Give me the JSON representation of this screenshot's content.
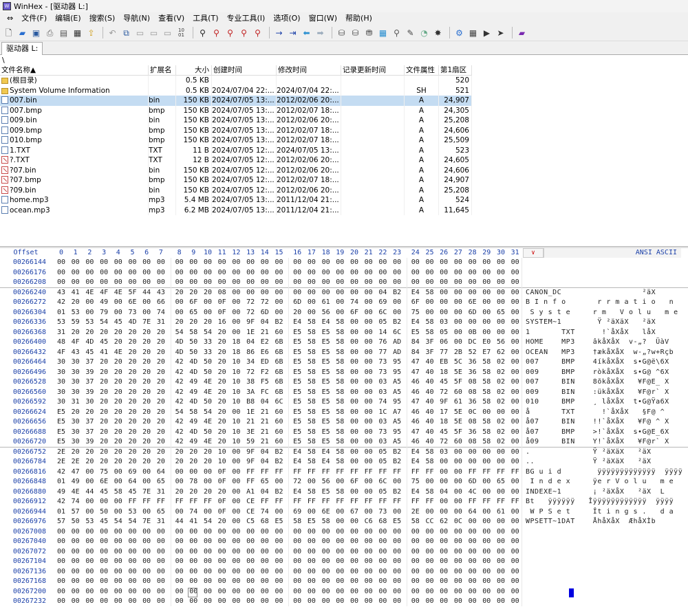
{
  "window": {
    "title": "WinHex - [驱动器 L:]"
  },
  "menu": [
    "文件(F)",
    "编辑(E)",
    "搜索(S)",
    "导航(N)",
    "查看(V)",
    "工具(T)",
    "专业工具(I)",
    "选项(O)",
    "窗口(W)",
    "帮助(H)"
  ],
  "tab": {
    "label": "驱动器 L:"
  },
  "path": "\\",
  "dir_columns": [
    "文件名称▲",
    "扩展名",
    "大小",
    "创建时间",
    "修改时间",
    "记录更新时间",
    "文件属性",
    "第1扇区"
  ],
  "dir_rows": [
    {
      "icon": "folder",
      "name": "(根目录)",
      "ext": "",
      "size": "0.5 KB",
      "created": "",
      "modified": "",
      "record": "",
      "attr": "",
      "sector": "520",
      "sel": false
    },
    {
      "icon": "folder",
      "name": "System Volume Information",
      "ext": "",
      "size": "0.5 KB",
      "created": "2024/07/04  22:...",
      "modified": "2024/07/04  22:...",
      "record": "",
      "attr": "SH",
      "sector": "521",
      "sel": false
    },
    {
      "icon": "file",
      "name": "007.bin",
      "ext": "bin",
      "size": "150 KB",
      "created": "2024/07/05  13:...",
      "modified": "2012/02/06  20:...",
      "record": "",
      "attr": "A",
      "sector": "24,907",
      "sel": true
    },
    {
      "icon": "file",
      "name": "007.bmp",
      "ext": "bmp",
      "size": "150 KB",
      "created": "2024/07/05  13:...",
      "modified": "2012/02/07  18:...",
      "record": "",
      "attr": "A",
      "sector": "24,305",
      "sel": false
    },
    {
      "icon": "file",
      "name": "009.bin",
      "ext": "bin",
      "size": "150 KB",
      "created": "2024/07/05  13:...",
      "modified": "2012/02/06  20:...",
      "record": "",
      "attr": "A",
      "sector": "25,208",
      "sel": false
    },
    {
      "icon": "file",
      "name": "009.bmp",
      "ext": "bmp",
      "size": "150 KB",
      "created": "2024/07/05  13:...",
      "modified": "2012/02/07  18:...",
      "record": "",
      "attr": "A",
      "sector": "24,606",
      "sel": false
    },
    {
      "icon": "file",
      "name": "010.bmp",
      "ext": "bmp",
      "size": "150 KB",
      "created": "2024/07/05  13:...",
      "modified": "2012/02/07  18:...",
      "record": "",
      "attr": "A",
      "sector": "25,509",
      "sel": false
    },
    {
      "icon": "file",
      "name": "1.TXT",
      "ext": "TXT",
      "size": "11 B",
      "created": "2024/07/05  12:...",
      "modified": "2024/07/05  13:...",
      "record": "",
      "attr": "A",
      "sector": "523",
      "sel": false
    },
    {
      "icon": "deleted",
      "name": "?.TXT",
      "ext": "TXT",
      "size": "12 B",
      "created": "2024/07/05  12:...",
      "modified": "2012/02/06  20:...",
      "record": "",
      "attr": "A",
      "sector": "24,605",
      "sel": false
    },
    {
      "icon": "deleted",
      "name": "?07.bin",
      "ext": "bin",
      "size": "150 KB",
      "created": "2024/07/05  12:...",
      "modified": "2012/02/06  20:...",
      "record": "",
      "attr": "A",
      "sector": "24,606",
      "sel": false
    },
    {
      "icon": "deleted",
      "name": "?07.bmp",
      "ext": "bmp",
      "size": "150 KB",
      "created": "2024/07/05  12:...",
      "modified": "2012/02/07  18:...",
      "record": "",
      "attr": "A",
      "sector": "24,907",
      "sel": false
    },
    {
      "icon": "deleted",
      "name": "?09.bin",
      "ext": "bin",
      "size": "150 KB",
      "created": "2024/07/05  12:...",
      "modified": "2012/02/06  20:...",
      "record": "",
      "attr": "A",
      "sector": "25,208",
      "sel": false
    },
    {
      "icon": "file",
      "name": "home.mp3",
      "ext": "mp3",
      "size": "5.4 MB",
      "created": "2024/07/05  13:...",
      "modified": "2011/12/04  21:...",
      "record": "",
      "attr": "A",
      "sector": "524",
      "sel": false
    },
    {
      "icon": "file",
      "name": "ocean.mp3",
      "ext": "mp3",
      "size": "6.2 MB",
      "created": "2024/07/05  13:...",
      "modified": "2011/12/04  21:...",
      "record": "",
      "attr": "A",
      "sector": "11,645",
      "sel": false
    }
  ],
  "hex_header": {
    "offset_label": "Offset",
    "columns": [
      "0",
      "1",
      "2",
      "3",
      "4",
      "5",
      "6",
      "7",
      "8",
      "9",
      "10",
      "11",
      "12",
      "13",
      "14",
      "15",
      "16",
      "17",
      "18",
      "19",
      "20",
      "21",
      "22",
      "23",
      "24",
      "25",
      "26",
      "27",
      "28",
      "29",
      "30",
      "31"
    ],
    "charset_dropdown": "∨",
    "charset_label": "ANSI ASCII"
  },
  "hex_rows": [
    {
      "off": "00266144",
      "hex": "00 00 00 00 00 00 00 00 00 00 00 00 00 00 00 00 00 00 00 00 00 00 00 00 00 00 00 00 00 00 00 00",
      "ascii": ""
    },
    {
      "off": "00266176",
      "hex": "00 00 00 00 00 00 00 00 00 00 00 00 00 00 00 00 00 00 00 00 00 00 00 00 00 00 00 00 00 00 00 00",
      "ascii": ""
    },
    {
      "off": "00266208",
      "hex": "00 00 00 00 00 00 00 00 00 00 00 00 00 00 00 00 00 00 00 00 00 00 00 00 00 00 00 00 00 00 00 00",
      "ascii": ""
    },
    {
      "off": "00266240",
      "hex": "43 41 4E 4F 4E 5F 44 43 20 20 20 08 00 00 00 00 00 00 00 00 00 00 04 B2 E4 58 00 00 00 00 00 00",
      "ascii": "CANON_DC                  ²äX"
    },
    {
      "off": "00266272",
      "hex": "42 20 00 49 00 6E 00 66 00 6F 00 0F 00 72 72 00 6D 00 61 00 74 00 69 00 6F 00 00 00 6E 00 00 00",
      "ascii": "B I n f o       r r m a t i o   n"
    },
    {
      "off": "00266304",
      "hex": "01 53 00 79 00 73 00 74 00 65 00 0F 00 72 6D 00 20 00 56 00 6F 00 6C 00 75 00 00 00 6D 00 65 00",
      "ascii": " S y s t e     r m   V o l u   m e"
    },
    {
      "off": "00266336",
      "hex": "53 59 53 54 45 4D 7E 31 20 20 20 16 00 9F 04 B2 E4 58 E4 58 00 00 05 B2 E4 58 03 00 00 00 00 00",
      "ascii": "SYSTEM~1        Ÿ ²äXäX   ²äX"
    },
    {
      "off": "00266368",
      "hex": "31 20 20 20 20 20 20 20 54 58 54 20 00 1E 21 60 E5 58 E5 58 00 00 14 6C E5 58 05 00 0B 00 00 00",
      "ascii": "1       TXT      !`åXåX   låX"
    },
    {
      "off": "00266400",
      "hex": "48 4F 4D 45 20 20 20 20 4D 50 33 20 18 04 E2 6B E5 58 E5 58 00 00 76 AD 84 3F 06 00 DC E0 56 00",
      "ascii": "HOME    MP3    âkåXåX  v-„?  ÜàV"
    },
    {
      "off": "00266432",
      "hex": "4F 43 45 41 4E 20 20 20 4D 50 33 20 18 86 E6 6B E5 58 E5 58 00 00 77 AD 84 3F 77 2B 52 E7 62 00",
      "ascii": "OCEAN   MP3    †ækåXåX  w-„?w+Rçb"
    },
    {
      "off": "00266464",
      "hex": "30 30 37 20 20 20 20 20 42 4D 50 20 10 34 ED 6B E5 58 E5 58 00 00 73 95 47 40 EB 5C 36 58 02 00",
      "ascii": "007     BMP    4íkåXåX  s•G@ë\\6X"
    },
    {
      "off": "00266496",
      "hex": "30 30 39 20 20 20 20 20 42 4D 50 20 10 72 F2 6B E5 58 E5 58 00 00 73 95 47 40 18 5E 36 58 02 00",
      "ascii": "009     BMP    ròkåXåX  s•G@ ^6X"
    },
    {
      "off": "00266528",
      "hex": "30 30 37 20 20 20 20 20 42 49 4E 20 10 38 F5 6B E5 58 E5 58 00 00 03 A5 46 40 45 5F 08 58 02 00",
      "ascii": "007     BIN    8õkåXåX   ¥F@E_ X"
    },
    {
      "off": "00266560",
      "hex": "30 30 39 20 20 20 20 20 42 49 4E 20 10 3A FC 6B E5 58 E5 58 00 00 03 A5 46 40 72 60 08 58 02 00",
      "ascii": "009     BIN    :ükåXåX   ¥F@r` X"
    },
    {
      "off": "00266592",
      "hex": "30 31 30 20 20 20 20 20 42 4D 50 20 10 B8 04 6C E5 58 E5 58 00 00 74 95 47 40 9F 61 36 58 02 00",
      "ascii": "010     BMP    ¸ låXåX  t•G@Ÿa6X"
    },
    {
      "off": "00266624",
      "hex": "E5 20 20 20 20 20 20 20 54 58 54 20 00 1E 21 60 E5 58 E5 58 00 00 1C A7 46 40 17 5E 0C 00 00 00",
      "ascii": "å       TXT      !`åXåX   §F@ ^"
    },
    {
      "off": "00266656",
      "hex": "E5 30 37 20 20 20 20 20 42 49 4E 20 10 21 21 60 E5 58 E5 58 00 00 03 A5 46 40 18 5E 08 58 02 00",
      "ascii": "å07     BIN    !!`åXåX   ¥F@ ^ X"
    },
    {
      "off": "00266688",
      "hex": "E5 30 37 20 20 20 20 20 42 4D 50 20 10 3E 21 60 E5 58 E5 58 00 00 73 95 47 40 45 5F 36 58 02 00",
      "ascii": "å07     BMP    >!`åXåX  s•G@E_6X"
    },
    {
      "off": "00266720",
      "hex": "E5 30 39 20 20 20 20 20 42 49 4E 20 10 59 21 60 E5 58 E5 58 00 00 03 A5 46 40 72 60 08 58 02 00",
      "ascii": "å09     BIN    Y!`åXåX   ¥F@r` X"
    },
    {
      "off": "00266752",
      "hex": "2E 20 20 20 20 20 20 20 20 20 20 10 00 9F 04 B2 E4 58 E4 58 00 00 05 B2 E4 58 03 00 00 00 00 00",
      "ascii": ".              Ÿ ²äXäX   ²äX"
    },
    {
      "off": "00266784",
      "hex": "2E 2E 20 20 20 20 20 20 20 20 20 10 00 9F 04 B2 E4 58 E4 58 00 00 05 B2 E4 58 00 00 00 00 00 00",
      "ascii": "..             Ÿ ²äXäX   ²äX"
    },
    {
      "off": "00266816",
      "hex": "42 47 00 75 00 69 00 64 00 00 00 0F 00 FF FF FF FF FF FF FF FF FF FF FF FF FF 00 00 FF FF FF FF",
      "ascii": "BG u i d        ÿÿÿÿÿÿÿÿÿÿÿÿÿ  ÿÿÿÿ"
    },
    {
      "off": "00266848",
      "hex": "01 49 00 6E 00 64 00 65 00 78 00 0F 00 FF 65 00 72 00 56 00 6F 00 6C 00 75 00 00 00 6D 00 65 00",
      "ascii": " I n d e x     ÿe r V o l u   m e"
    },
    {
      "off": "00266880",
      "hex": "49 4E 44 45 58 45 7E 31 20 20 20 20 00 A1 04 B2 E4 58 E5 58 00 00 05 B2 E4 58 04 00 4C 00 00 00",
      "ascii": "INDEXE~1       ¡ ²äXåX   ²äX  L"
    },
    {
      "off": "00266912",
      "hex": "42 74 00 00 00 FF FF FF FF FF FF 0F 00 CE FF FF FF FF FF FF FF FF FF FF FF FF 00 00 FF FF FF FF",
      "ascii": "Bt   ÿÿÿÿÿÿ   Îÿÿÿÿÿÿÿÿÿÿÿÿ  ÿÿÿÿ"
    },
    {
      "off": "00266944",
      "hex": "01 57 00 50 00 53 00 65 00 74 00 0F 00 CE 74 00 69 00 6E 00 67 00 73 00 2E 00 00 00 64 00 61 00",
      "ascii": " W P S e t     Ît i n g s .   d a"
    },
    {
      "off": "00266976",
      "hex": "57 50 53 45 54 54 7E 31 44 41 54 20 00 C5 68 E5 58 E5 58 00 00 C6 68 E5 58 CC 62 0C 00 00 00 00",
      "ascii": "WPSETT~1DAT    ÅhåXåX  ÆhåXÌb"
    },
    {
      "off": "00267008",
      "hex": "00 00 00 00 00 00 00 00 00 00 00 00 00 00 00 00 00 00 00 00 00 00 00 00 00 00 00 00 00 00 00 00",
      "ascii": ""
    },
    {
      "off": "00267040",
      "hex": "00 00 00 00 00 00 00 00 00 00 00 00 00 00 00 00 00 00 00 00 00 00 00 00 00 00 00 00 00 00 00 00",
      "ascii": ""
    },
    {
      "off": "00267072",
      "hex": "00 00 00 00 00 00 00 00 00 00 00 00 00 00 00 00 00 00 00 00 00 00 00 00 00 00 00 00 00 00 00 00",
      "ascii": ""
    },
    {
      "off": "00267104",
      "hex": "00 00 00 00 00 00 00 00 00 00 00 00 00 00 00 00 00 00 00 00 00 00 00 00 00 00 00 00 00 00 00 00",
      "ascii": ""
    },
    {
      "off": "00267136",
      "hex": "00 00 00 00 00 00 00 00 00 00 00 00 00 00 00 00 00 00 00 00 00 00 00 00 00 00 00 00 00 00 00 00",
      "ascii": ""
    },
    {
      "off": "00267168",
      "hex": "00 00 00 00 00 00 00 00 00 00 00 00 00 00 00 00 00 00 00 00 00 00 00 00 00 00 00 00 00 00 00 00",
      "ascii": ""
    },
    {
      "off": "00267200",
      "hex": "00 00 00 00 00 00 00 00 00 00 00 00 00 00 00 00 00 00 00 00 00 00 00 00 00 00 00 00 00 00 00 00",
      "ascii": ""
    },
    {
      "off": "00267232",
      "hex": "00 00 00 00 00 00 00 00 00 00 00 00 00 00 00 00 00 00 00 00 00 00 00 00 00 00 00 00 00 00 00 00",
      "ascii": ""
    }
  ],
  "toolbar_icons": [
    "new-file-icon",
    "open-icon",
    "save-icon",
    "print-icon",
    "properties-icon",
    "open-disk-icon",
    "undo-icon",
    "copy-icon",
    "paste-icon",
    "fill-icon",
    "find-text-icon",
    "find-hex-icon",
    "replace-text-icon",
    "replace-hex-icon",
    "goto-offset-icon",
    "back-icon",
    "forward-icon",
    "disk-editor-icon",
    "ram-editor-icon",
    "calculator-icon",
    "analyze-icon",
    "case-icon",
    "hash-icon",
    "ole-icon",
    "settings-icon",
    "help-icon"
  ]
}
